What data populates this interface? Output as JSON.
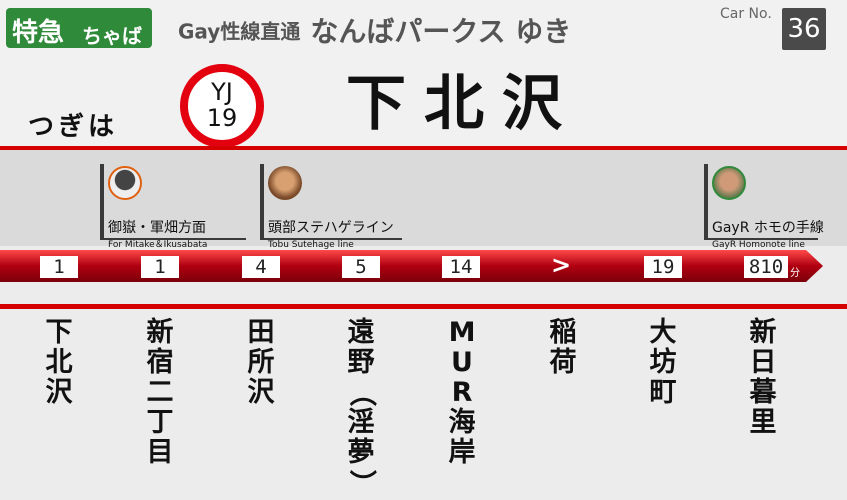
{
  "train_type": {
    "label": "特急",
    "line": "ちゃば"
  },
  "destination": {
    "prefix": "Gay性線直通",
    "name": "なんばパークス ゆき"
  },
  "car": {
    "label": "Car No.",
    "number": "36"
  },
  "next": {
    "label": "つぎは"
  },
  "station_number": {
    "line_code": "YJ",
    "number": "19"
  },
  "station_name": "下北沢",
  "transfers": [
    {
      "jp": "御嶽・軍畑方面",
      "en": "For Mitake＆Ikusabata",
      "photo": "portrait-icon"
    },
    {
      "jp": "頭部ステハゲライン",
      "en": "Tobu Sutehage line",
      "photo": "portrait-icon"
    },
    {
      "jp": "GayR ホモの手線",
      "en": "GayR Homonote line",
      "photo": "portrait-icon"
    }
  ],
  "times": [
    "1",
    "1",
    "4",
    "5",
    "14",
    "19",
    "810"
  ],
  "separator": ">",
  "time_unit": "分",
  "stations": [
    "下北沢",
    "新宿二丁目",
    "田所沢",
    "遠野（淫夢）",
    "MUR海岸",
    "稲荷",
    "大坊町",
    "新日暮里"
  ],
  "colors": {
    "accent_red": "#d50000",
    "express_green": "#2f8a3a",
    "track_red": "#b00010"
  }
}
